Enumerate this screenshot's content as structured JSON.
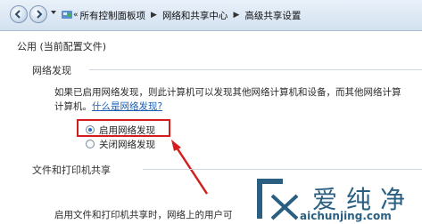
{
  "breadcrumb": {
    "root_chevron": "«",
    "items": [
      "所有控制面板项",
      "网络和共享中心",
      "高级共享设置"
    ]
  },
  "profile": {
    "title": "公用 (当前配置文件)"
  },
  "network_discovery": {
    "heading": "网络发现",
    "description_line1": "如果已启用网络发现，则此计算机可以发现其他网络计算机和设备，而其他网络计算",
    "description_line2": "计算机。",
    "help_link": "什么是网络发现?",
    "options": [
      {
        "label": "启用网络发现",
        "selected": true
      },
      {
        "label": "关闭网络发现",
        "selected": false
      }
    ]
  },
  "file_printer_sharing": {
    "heading": "文件和打印机共享",
    "description": "启用文件和打印机共享时，网络上的用户可"
  },
  "watermark": {
    "brand": "爱纯净",
    "url": "aichunjing.com"
  },
  "colors": {
    "highlight": "#d41d1d",
    "link": "#1a5fb4",
    "brand": "#2a5f82"
  }
}
